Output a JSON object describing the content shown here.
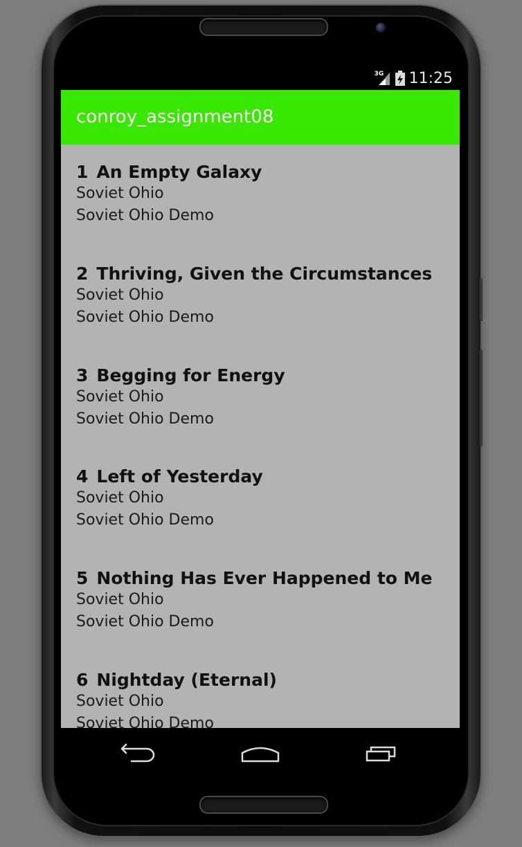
{
  "status_bar": {
    "network": "3G",
    "time": "11:25"
  },
  "app_bar": {
    "title": "conroy_assignment08"
  },
  "tracks": [
    {
      "number": "1",
      "title": "An Empty Galaxy",
      "artist": "Soviet Ohio",
      "album": "Soviet Ohio Demo"
    },
    {
      "number": "2",
      "title": "Thriving, Given the Circumstances",
      "artist": "Soviet Ohio",
      "album": "Soviet Ohio Demo"
    },
    {
      "number": "3",
      "title": "Begging for Energy",
      "artist": "Soviet Ohio",
      "album": "Soviet Ohio Demo"
    },
    {
      "number": "4",
      "title": "Left of Yesterday",
      "artist": "Soviet Ohio",
      "album": "Soviet Ohio Demo"
    },
    {
      "number": "5",
      "title": "Nothing Has Ever Happened to Me",
      "artist": "Soviet Ohio",
      "album": "Soviet Ohio Demo"
    },
    {
      "number": "6",
      "title": "Nightday (Eternal)",
      "artist": "Soviet Ohio",
      "album": "Soviet Ohio Demo"
    }
  ],
  "colors": {
    "app_bar": "#39e800",
    "list_background": "#b3b3b3"
  },
  "icons": {
    "back": "back-icon",
    "home": "home-icon",
    "recents": "recents-icon"
  }
}
